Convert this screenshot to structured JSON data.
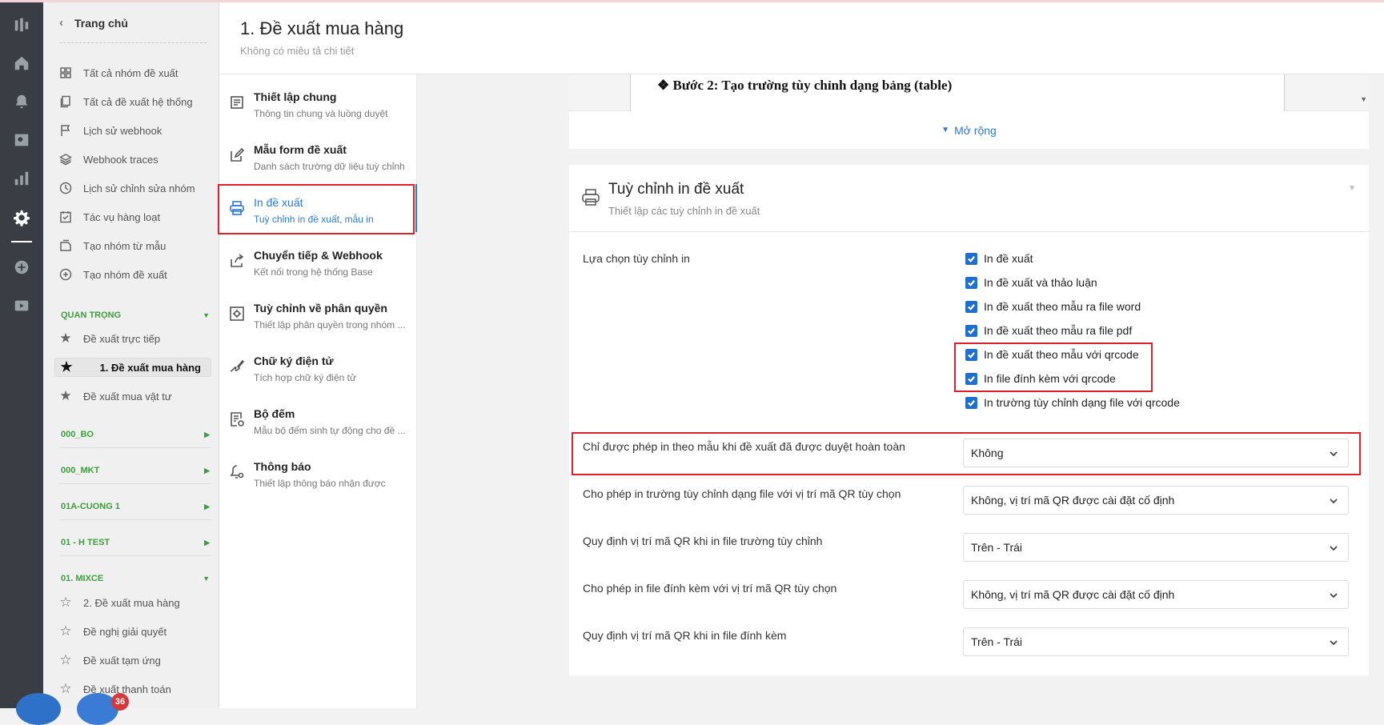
{
  "rail": {
    "icons": [
      "logo-icon",
      "home-icon",
      "bell-icon",
      "search-icon",
      "chart-icon",
      "gear-icon",
      "plus-circle-icon",
      "video-icon"
    ]
  },
  "sidebar": {
    "home_label": "Trang chủ",
    "items": [
      {
        "label": "Tất cả nhóm đề xuất",
        "icon": "grid-icon"
      },
      {
        "label": "Tất cả đề xuất hệ thống",
        "icon": "copy-icon"
      },
      {
        "label": "Lịch sử webhook",
        "icon": "flag-icon"
      },
      {
        "label": "Webhook traces",
        "icon": "layers-icon"
      },
      {
        "label": "Lịch sử chỉnh sửa nhóm",
        "icon": "clock-icon"
      },
      {
        "label": "Tác vụ hàng loạt",
        "icon": "checklist-icon"
      },
      {
        "label": "Tạo nhóm từ mẫu",
        "icon": "template-icon"
      },
      {
        "label": "Tạo nhóm đề xuất",
        "icon": "plus-circle-icon"
      }
    ],
    "groups": [
      {
        "name": "QUAN TRỌNG",
        "items": [
          "Đề xuất trực tiếp",
          "1. Đề xuất mua hàng",
          "Đề xuất mua vật tư"
        ],
        "selected": "1. Đề xuất mua hàng"
      },
      {
        "name": "000_BO"
      },
      {
        "name": "000_MKT"
      },
      {
        "name": "01A-CUONG 1"
      },
      {
        "name": "01 - H TEST"
      },
      {
        "name": "01. MIXCE",
        "items": [
          "2. Đề xuất mua hàng",
          "Đề nghị giải quyết",
          "Đề xuất tạm ứng",
          "Đề xuất thanh toán"
        ]
      }
    ],
    "notification_count": "36"
  },
  "header": {
    "title": "1. Đề xuất mua hàng",
    "subtitle": "Không có miêu tả chi tiết"
  },
  "settings_menu": [
    {
      "title": "Thiết lập chung",
      "desc": "Thông tin chung và luồng duyệt",
      "icon": "document-icon"
    },
    {
      "title": "Mẫu form đề xuất",
      "desc": "Danh sách trường dữ liệu tuỳ chỉnh",
      "icon": "edit-icon"
    },
    {
      "title": "In đề xuất",
      "desc": "Tuỳ chỉnh in đề xuất, mẫu in",
      "icon": "printer-icon",
      "active": true
    },
    {
      "title": "Chuyển tiếp & Webhook",
      "desc": "Kết nối trong hệ thống Base",
      "icon": "share-icon"
    },
    {
      "title": "Tuỳ chỉnh về phân quyền",
      "desc": "Thiết lập phân quyền trong nhóm ...",
      "icon": "settings-box-icon"
    },
    {
      "title": "Chữ ký điện tử",
      "desc": "Tích hợp chữ ký điện tử",
      "icon": "signature-icon"
    },
    {
      "title": "Bộ đếm",
      "desc": "Mẫu bộ đếm sinh tự động cho đề ...",
      "icon": "counter-icon"
    },
    {
      "title": "Thông báo",
      "desc": "Thiết lập thông báo nhận được",
      "icon": "bell-gear-icon"
    }
  ],
  "preview": {
    "step_text": "❖ Bước 2: Tạo trường tùy chỉnh dạng bảng (table)",
    "expand_label": "Mở rộng"
  },
  "print_card": {
    "title": "Tuỳ chỉnh in đề xuất",
    "subtitle": "Thiết lập các tuỳ chỉnh in đề xuất",
    "options_label": "Lựa chọn tùy chỉnh in",
    "options": [
      {
        "label": "In đề xuất",
        "checked": true
      },
      {
        "label": "In đề xuất và thảo luận",
        "checked": true
      },
      {
        "label": "In đề xuất theo mẫu ra file word",
        "checked": true
      },
      {
        "label": "In đề xuất theo mẫu ra file pdf",
        "checked": true
      },
      {
        "label": "In đề xuất theo mẫu với qrcode",
        "checked": true
      },
      {
        "label": "In file đính kèm với qrcode",
        "checked": true
      },
      {
        "label": "In trường tùy chỉnh dạng file với qrcode",
        "checked": true
      }
    ],
    "rules": [
      {
        "label": "Chỉ được phép in theo mẫu khi đề xuất đã được duyệt hoàn toàn",
        "value": "Không"
      },
      {
        "label": "Cho phép in trường tùy chỉnh dạng file với vị trí mã QR tùy chọn",
        "value": "Không, vị trí mã QR được cài đặt cố định"
      },
      {
        "label": "Quy định vị trí mã QR khi in file trường tùy chỉnh",
        "value": "Trên - Trái"
      },
      {
        "label": "Cho phép in file đính kèm với vị trí mã QR tùy chọn",
        "value": "Không, vị trí mã QR được cài đặt cố định"
      },
      {
        "label": "Quy định vị trí mã QR khi in file đính kèm",
        "value": "Trên - Trái"
      }
    ]
  }
}
